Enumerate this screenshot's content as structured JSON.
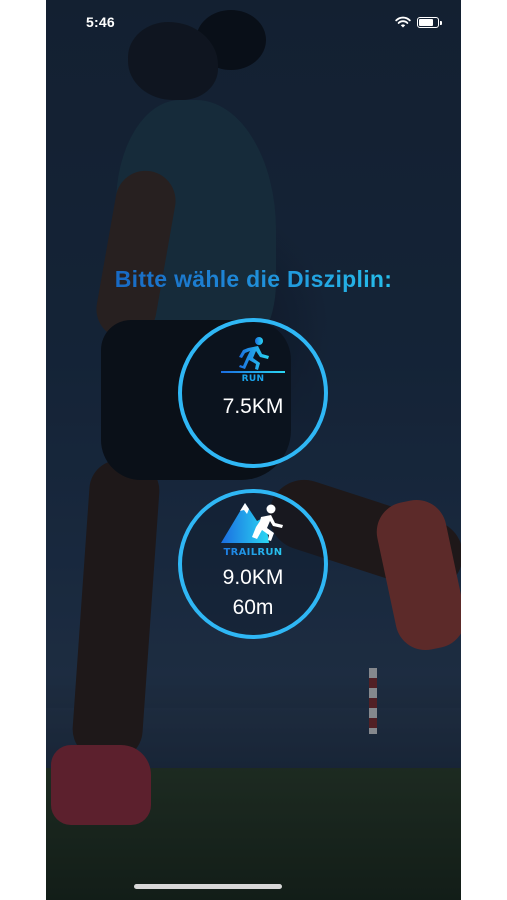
{
  "status_bar": {
    "time": "5:46",
    "battery_level": 0.85
  },
  "heading": "Bitte wähle die Disziplin:",
  "disciplines": [
    {
      "badge": "RUN",
      "distance": "7.5KM",
      "elevation": "",
      "icon": "runner-icon"
    },
    {
      "badge": "TRAILRUN",
      "distance": "9.0KM",
      "elevation": "60m",
      "icon": "mountain-runner-icon"
    }
  ],
  "colors": {
    "accent": "#2fb7f5",
    "heading_start": "#1558b8",
    "heading_end": "#2ad7f3"
  }
}
